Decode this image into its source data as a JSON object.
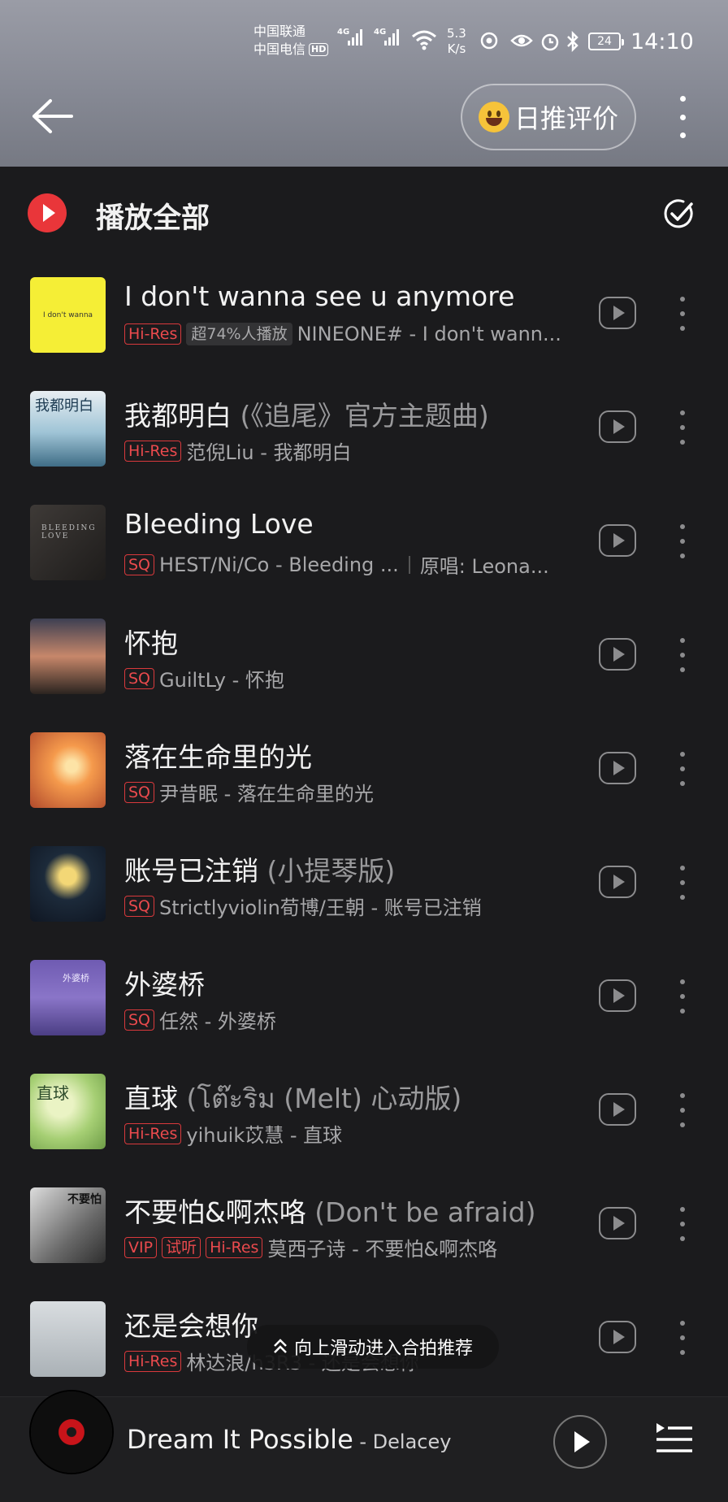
{
  "status_bar": {
    "carrier1": "中国联通",
    "carrier2": "中国电信",
    "hd": "HD",
    "net1": "4G",
    "net2": "4G",
    "speed_value": "5.3",
    "speed_unit": "K/s",
    "battery": "24",
    "time": "14:10"
  },
  "header": {
    "back_icon": "arrow-left-icon",
    "rate_label": "日推评价",
    "rate_icon": "grinning-emoji-icon",
    "more_icon": "vertical-ellipsis-icon"
  },
  "play_all": {
    "label": "播放全部",
    "icon": "play-circle-icon",
    "multi_select_icon": "check-circle-icon",
    "accent": "#e9363a"
  },
  "songs": [
    {
      "title": "I don't wanna see u anymore",
      "subtitle": "",
      "tags": [
        "Hi-Res"
      ],
      "popularity": "超74%人播放",
      "artist_line": "NINEONE# - I don't wann...",
      "cover_text": "I don't wanna",
      "extra": ""
    },
    {
      "title": "我都明白",
      "subtitle": " (《追尾》官方主题曲)",
      "tags": [
        "Hi-Res"
      ],
      "popularity": "",
      "artist_line": "范倪Liu - 我都明白",
      "cover_text": "我都明白",
      "extra": ""
    },
    {
      "title": "Bleeding Love",
      "subtitle": "",
      "tags": [
        "SQ"
      ],
      "popularity": "",
      "artist_line": "HEST/Ni/Co - Bleeding ...",
      "cover_text": "BLEEDING LOVE",
      "extra": "原唱: Leona..."
    },
    {
      "title": "怀抱",
      "subtitle": "",
      "tags": [
        "SQ"
      ],
      "popularity": "",
      "artist_line": "GuiltLy - 怀抱",
      "cover_text": "",
      "extra": ""
    },
    {
      "title": "落在生命里的光",
      "subtitle": "",
      "tags": [
        "SQ"
      ],
      "popularity": "",
      "artist_line": "尹昔眠 - 落在生命里的光",
      "cover_text": "",
      "extra": ""
    },
    {
      "title": "账号已注销",
      "subtitle": " (小提琴版)",
      "tags": [
        "SQ"
      ],
      "popularity": "",
      "artist_line": "Strictlyviolin荀博/王朝 - 账号已注销",
      "cover_text": "",
      "extra": ""
    },
    {
      "title": "外婆桥",
      "subtitle": "",
      "tags": [
        "SQ"
      ],
      "popularity": "",
      "artist_line": "任然 - 外婆桥",
      "cover_text": "外婆桥",
      "extra": ""
    },
    {
      "title": "直球",
      "subtitle": " (โต๊ะริม (Melt) 心动版)",
      "tags": [
        "Hi-Res"
      ],
      "popularity": "",
      "artist_line": "yihuik苡慧 - 直球",
      "cover_text": "直球",
      "extra": ""
    },
    {
      "title": "不要怕&啊杰咯",
      "subtitle": " (Don't be afraid)",
      "tags": [
        "VIP",
        "试听",
        "Hi-Res"
      ],
      "popularity": "",
      "artist_line": "莫西子诗 - 不要怕&啊杰咯",
      "cover_text": "不要怕",
      "extra": ""
    },
    {
      "title": "还是会想你",
      "subtitle": "",
      "tags": [
        "Hi-Res"
      ],
      "popularity": "",
      "artist_line": "林达浪/h3R3 - 还是会想你",
      "cover_text": "",
      "extra": ""
    }
  ],
  "toast": {
    "label": "向上滑动进入合拍推荐",
    "icon": "double-chevron-up-icon"
  },
  "mini_player": {
    "title": "Dream It Possible",
    "artist": " - Delacey",
    "play_icon": "play-icon",
    "playlist_icon": "playlist-icon"
  }
}
